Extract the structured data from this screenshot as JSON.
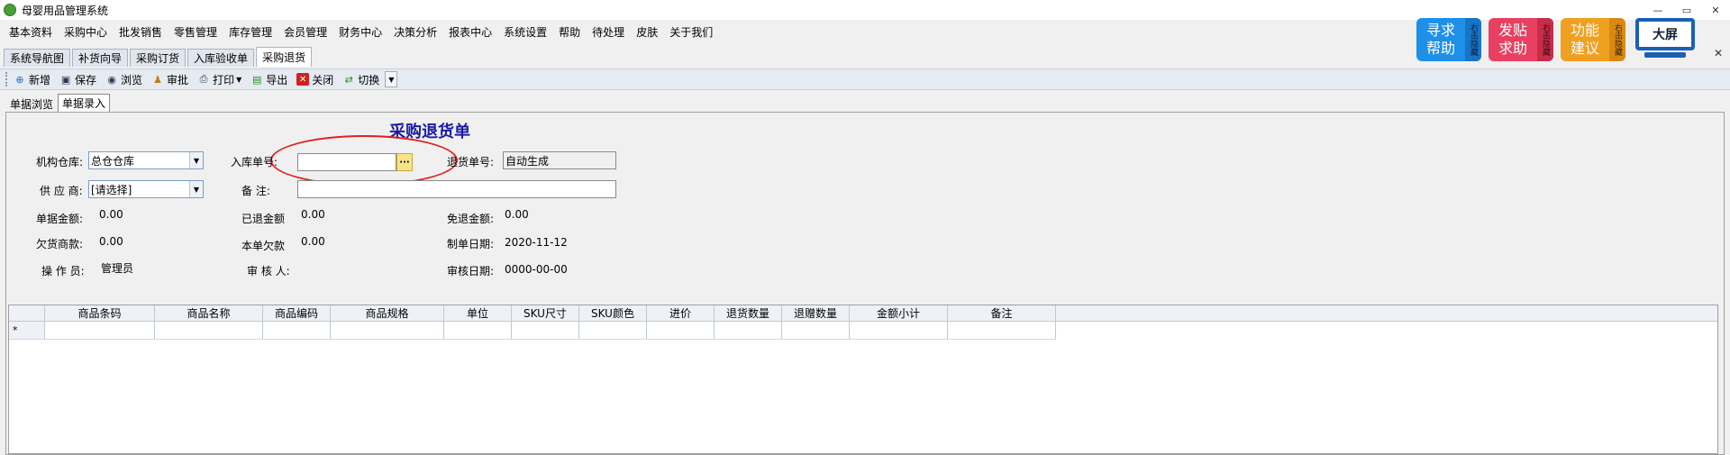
{
  "window": {
    "title": "母婴用品管理系统",
    "controls": [
      "—",
      "▭",
      "✕"
    ]
  },
  "menu": [
    "基本资料",
    "采购中心",
    "批发销售",
    "零售管理",
    "库存管理",
    "会员管理",
    "财务中心",
    "决策分析",
    "报表中心",
    "系统设置",
    "帮助",
    "待处理",
    "皮肤",
    "关于我们"
  ],
  "top_buttons": {
    "help": {
      "line1": "寻求",
      "line2": "帮助",
      "side": "右击隐藏"
    },
    "post": {
      "line1": "发贴",
      "line2": "求助",
      "side": "右击隐藏"
    },
    "suggest": {
      "line1": "功能",
      "line2": "建议",
      "side": "右击隐藏"
    },
    "bigscreen": "大屏"
  },
  "tabs": [
    "系统导航图",
    "补货向导",
    "采购订货",
    "入库验收单",
    "采购退货"
  ],
  "toolbar": {
    "new": "新增",
    "save": "保存",
    "browse": "浏览",
    "approve": "审批",
    "print": "打印",
    "export": "导出",
    "close": "关闭",
    "switch": "切换"
  },
  "subtabs": [
    "单据浏览",
    "单据录入"
  ],
  "form": {
    "title": "采购退货单",
    "warehouse_label": "机构仓库:",
    "warehouse_value": "总仓仓库",
    "inbound_label": "入库单号:",
    "inbound_value": "",
    "return_no_label": "退货单号:",
    "return_no_value": "自动生成",
    "supplier_label": "供 应 商:",
    "supplier_value": "[请选择]",
    "remark_label": "备    注:",
    "remark_value": "",
    "amount_label": "单据金额:",
    "amount_value": "0.00",
    "refunded_label": "已退金额",
    "refunded_value": "0.00",
    "waived_label": "免退金额:",
    "waived_value": "0.00",
    "owed_label": "欠货商款:",
    "owed_value": "0.00",
    "this_owed_label": "本单欠款",
    "this_owed_value": "0.00",
    "date_label": "制单日期:",
    "date_value": "2020-11-12",
    "operator_label": "操 作 员:",
    "operator_value": "管理员",
    "auditor_label": "审 核 人:",
    "auditor_value": "",
    "audit_date_label": "审核日期:",
    "audit_date_value": "0000-00-00"
  },
  "grid": {
    "columns": [
      "",
      "商品条码",
      "商品名称",
      "商品编码",
      "商品规格",
      "单位",
      "SKU尺寸",
      "SKU颜色",
      "进价",
      "退货数量",
      "退赠数量",
      "金额小计",
      "备注"
    ],
    "new_row_marker": "*"
  }
}
